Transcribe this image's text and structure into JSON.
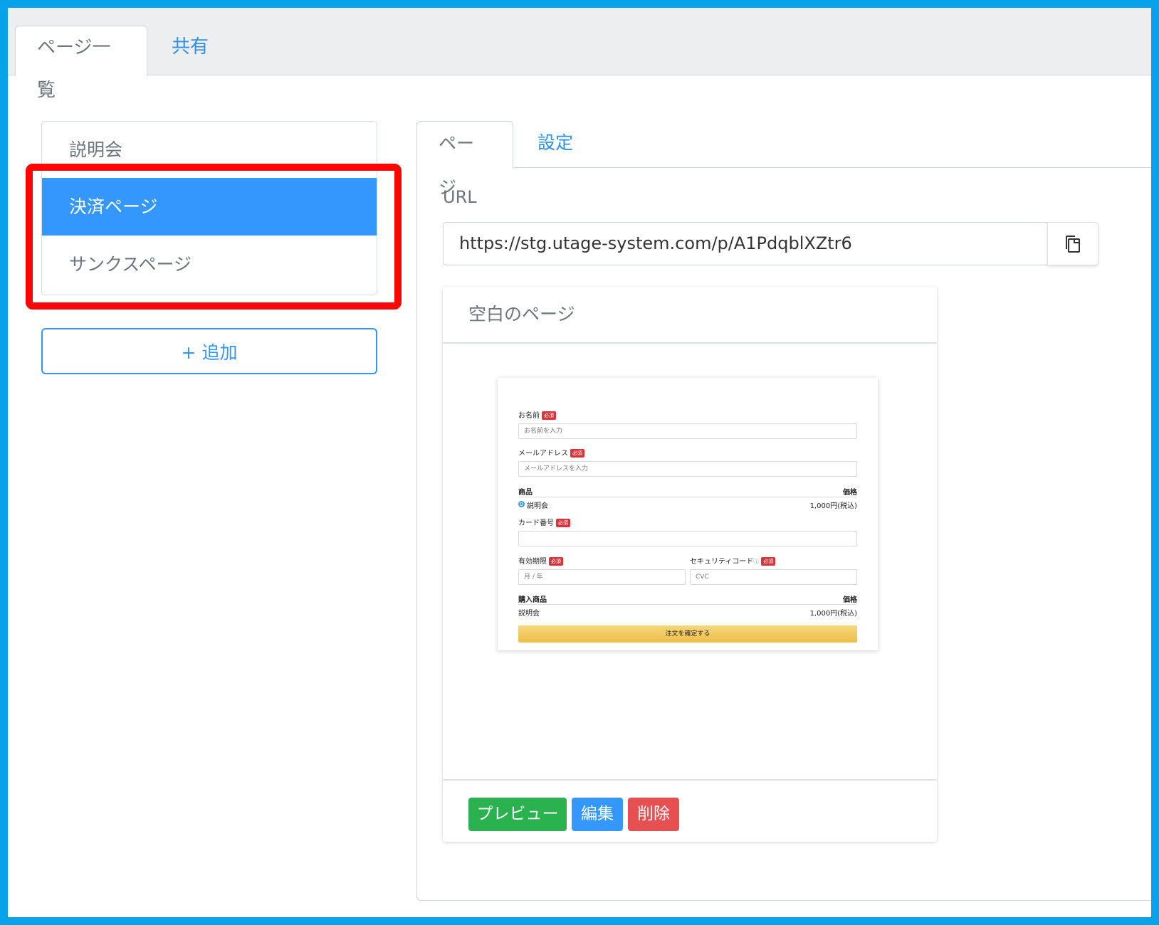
{
  "top_tabs": {
    "list": "ページ一覧",
    "share": "共有"
  },
  "page_list": {
    "items": [
      {
        "label": "説明会"
      },
      {
        "label": "決済ページ"
      },
      {
        "label": "サンクスページ"
      }
    ],
    "add_label": "+ 追加"
  },
  "sub_tabs": {
    "page": "ページ",
    "settings": "設定"
  },
  "url": {
    "label": "URL",
    "value": "https://stg.utage-system.com/p/A1PdqblXZtr6"
  },
  "card": {
    "title": "空白のページ",
    "preview_label": "プレビュー",
    "edit_label": "編集",
    "delete_label": "削除"
  },
  "thumbnail": {
    "required": "必須",
    "name_label": "お名前",
    "name_placeholder": "お名前を入力",
    "email_label": "メールアドレス",
    "email_placeholder": "メールアドレスを入力",
    "product_header": "商品",
    "price_header": "価格",
    "product_name": "説明会",
    "product_price": "1,000円(税込)",
    "card_label": "カード番号",
    "expiry_label": "有効期限",
    "expiry_placeholder": "月 / 年",
    "security_label": "セキュリティコード",
    "security_placeholder": "CVC",
    "purchased_header": "購入商品",
    "purchased_price_header": "価格",
    "purchased_name": "説明会",
    "purchased_price": "1,000円(税込)",
    "submit_label": "注文を確定する"
  },
  "colors": {
    "accent": "#3497fb",
    "highlight": "#fb0505",
    "preview": "#29b24e",
    "delete": "#e65051",
    "frame": "#07a2ea"
  }
}
